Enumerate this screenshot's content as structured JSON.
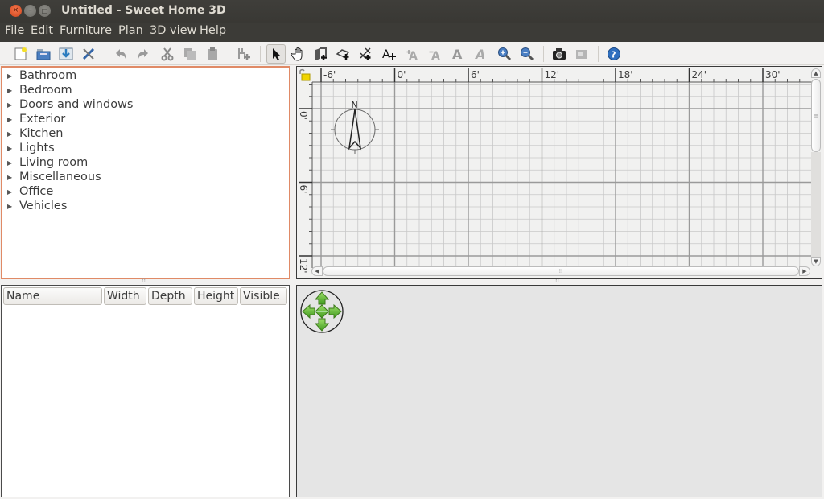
{
  "window": {
    "title": "Untitled - Sweet Home 3D",
    "controls": {
      "close": "×",
      "minimize": "–",
      "maximize": "□"
    }
  },
  "menu": [
    {
      "label": "File",
      "mnemonic": "F"
    },
    {
      "label": "Edit",
      "mnemonic": "E"
    },
    {
      "label": "Furniture",
      "mnemonic": "u"
    },
    {
      "label": "Plan",
      "mnemonic": "P"
    },
    {
      "label": "3D view",
      "mnemonic": "v"
    },
    {
      "label": "Help",
      "mnemonic": "H"
    }
  ],
  "toolbar": {
    "items": [
      {
        "icon": "new-home-icon",
        "enabled": true
      },
      {
        "icon": "open-icon",
        "enabled": true
      },
      {
        "icon": "save-icon",
        "enabled": true
      },
      {
        "icon": "preferences-icon",
        "enabled": true
      },
      {
        "icon": "undo-icon",
        "enabled": false
      },
      {
        "icon": "redo-icon",
        "enabled": false
      },
      {
        "icon": "cut-icon",
        "enabled": false
      },
      {
        "icon": "copy-icon",
        "enabled": false
      },
      {
        "icon": "paste-icon",
        "enabled": false
      },
      {
        "icon": "add-furniture-icon",
        "enabled": false
      },
      {
        "icon": "select-mode-icon",
        "enabled": true,
        "selected": true
      },
      {
        "icon": "pan-mode-icon",
        "enabled": true
      },
      {
        "icon": "create-walls-icon",
        "enabled": true
      },
      {
        "icon": "create-rooms-icon",
        "enabled": true
      },
      {
        "icon": "create-dimensions-icon",
        "enabled": true
      },
      {
        "icon": "add-text-icon",
        "enabled": true
      },
      {
        "icon": "increase-text-size-icon",
        "enabled": false
      },
      {
        "icon": "decrease-text-size-icon",
        "enabled": false
      },
      {
        "icon": "bold-text-icon",
        "enabled": false
      },
      {
        "icon": "italic-text-icon",
        "enabled": false
      },
      {
        "icon": "zoom-in-icon",
        "enabled": true
      },
      {
        "icon": "zoom-out-icon",
        "enabled": true
      },
      {
        "icon": "create-photo-icon",
        "enabled": true
      },
      {
        "icon": "create-video-icon",
        "enabled": false
      },
      {
        "icon": "help-icon",
        "enabled": true
      }
    ]
  },
  "catalog": {
    "categories": [
      "Bathroom",
      "Bedroom",
      "Doors and windows",
      "Exterior",
      "Kitchen",
      "Lights",
      "Living room",
      "Miscellaneous",
      "Office",
      "Vehicles"
    ],
    "focus_color": "#e08a66"
  },
  "furniture_table": {
    "columns": [
      "Name",
      "Width",
      "Depth",
      "Height",
      "Visible"
    ],
    "rows": []
  },
  "plan": {
    "unit": "feet",
    "x_ruler_labels": [
      "-6'",
      "0'",
      "6'",
      "12'",
      "18'",
      "24'",
      "30'"
    ],
    "y_ruler_labels": [
      "0'",
      "6'",
      "12'"
    ],
    "compass_label": "N",
    "grid_color": "#c8c8c8",
    "major_grid_color": "#9a9a9a"
  },
  "view3d": {
    "navigation": "arrows-navigator",
    "arrow_color": "#6cbf3a"
  }
}
